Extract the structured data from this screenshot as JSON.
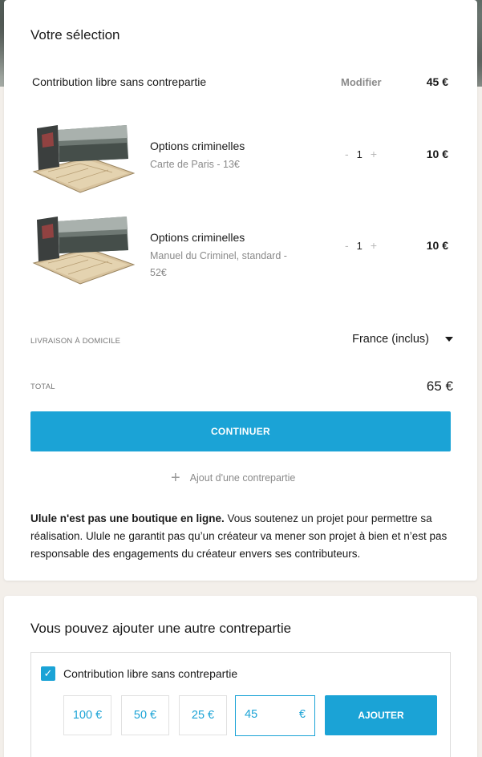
{
  "selection": {
    "title": "Votre sélection",
    "free_contribution": {
      "label": "Contribution libre sans contrepartie",
      "modify_label": "Modifier",
      "price": "45 €"
    },
    "items": [
      {
        "name": "Options criminelles",
        "subtitle": "Carte de Paris - 13€",
        "qty": "1",
        "price": "10 €",
        "image_icon": "boxed-map-image"
      },
      {
        "name": "Options criminelles",
        "subtitle": "Manuel du Criminel, standard - 52€",
        "qty": "1",
        "price": "10 €",
        "image_icon": "boxed-map-image"
      }
    ],
    "stepper": {
      "minus": "-",
      "plus": "+"
    },
    "shipping": {
      "label": "LIVRAISON À DOMICILE",
      "value": "France (inclus)"
    },
    "total": {
      "label": "TOTAL",
      "value": "65 €"
    },
    "continue_label": "CONTINUER",
    "add_reward_plus": "+",
    "add_reward_label": "Ajout d'une contrepartie",
    "disclaimer_bold": "Ulule n'est pas une boutique en ligne.",
    "disclaimer_rest": " Vous soutenez un projet pour permettre sa réalisation. Ulule ne garantit pas qu’un créateur va mener son projet à bien et n’est pas responsable des engagements du créateur envers ses contributeurs."
  },
  "other_reward": {
    "title": "Vous pouvez ajouter une autre contrepartie",
    "checkbox_label": "Contribution libre sans contrepartie",
    "checkbox_checked": true,
    "checkbox_mark": "✓",
    "amounts": [
      "100 €",
      "50 €",
      "25 €"
    ],
    "input_value": "45",
    "input_currency": "€",
    "add_label": "AJOUTER"
  },
  "colors": {
    "accent": "#1ba3d6",
    "page_bg": "#f3efea",
    "muted_text": "#8a8a8a"
  }
}
